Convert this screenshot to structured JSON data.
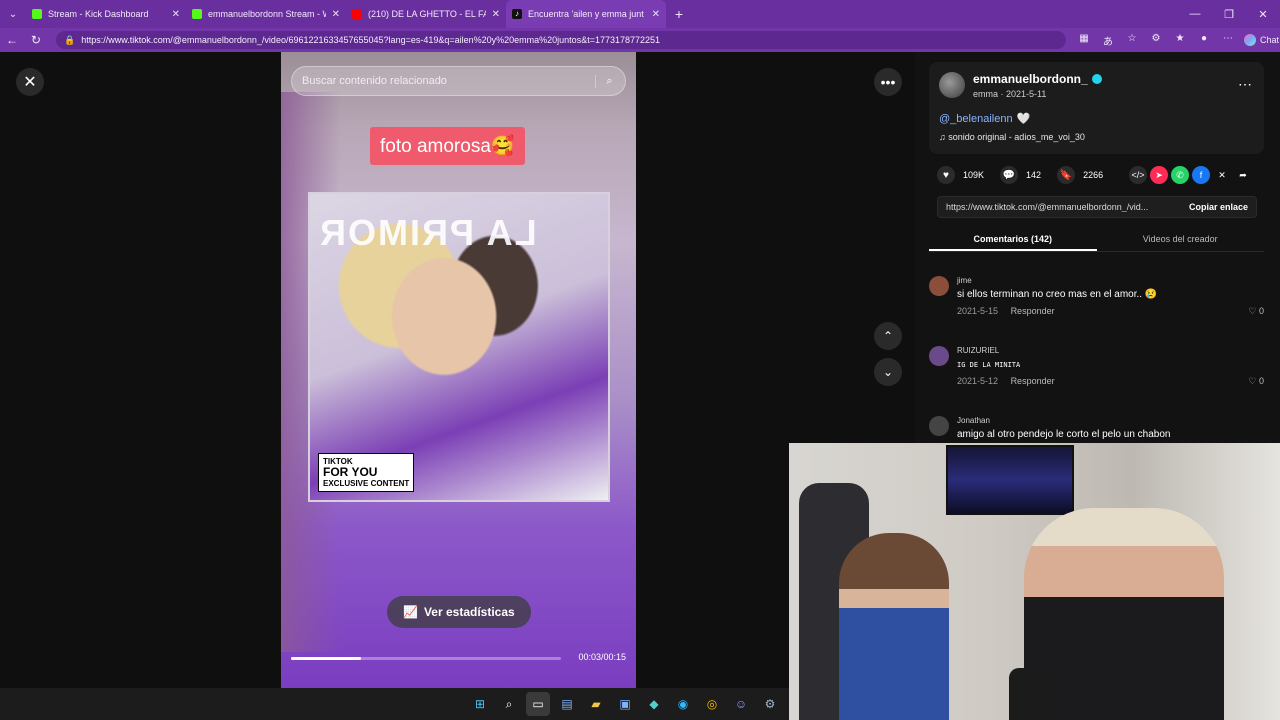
{
  "browser": {
    "tabs": [
      {
        "title": "Stream - Kick Dashboard",
        "favicon_color": "#53fc18"
      },
      {
        "title": "emmanuelbordonn Stream - Watc",
        "favicon_color": "#53fc18"
      },
      {
        "title": "(210) DE LA GHETTO - EL FATHER",
        "favicon_color": "#ff0000"
      },
      {
        "title": "Encuentra 'ailen y emma junt",
        "favicon_color": "#ffffff"
      }
    ],
    "url": "https://www.tiktok.com/@emmanuelbordonn_/video/6961221633457655045?lang=es-419&q=ailen%20y%20emma%20juntos&t=1773178772251",
    "chat_label": "Chat"
  },
  "video": {
    "search_placeholder": "Buscar contenido relacionado",
    "caption_text": "foto amorosa🥰",
    "photo_overlay_text": "LA PRIMOR",
    "stamp_line1": "TIKTOK",
    "stamp_line2": "FOR YOU",
    "stamp_line3": "EXCLUSIVE CONTENT",
    "stats_button": "Ver estadísticas",
    "time": "00:03/00:15",
    "progress_fraction": 0.26
  },
  "panel": {
    "username": "emmanuelbordonn_",
    "subline": "emma · 2021-5-11",
    "mention": "@_belenailenn",
    "sound": "sonido original - adios_me_voi_30",
    "likes": "109K",
    "comments_count": "142",
    "saves": "2266",
    "link": "https://www.tiktok.com/@emmanuelbordonn_/vid...",
    "copy_label": "Copiar enlace",
    "tab_comments": "Comentarios (142)",
    "tab_videos": "Videos del creador",
    "reply_label": "Responder",
    "comments": [
      {
        "user": "jime",
        "text": "si ellos terminan no creo mas en el amor.. 😢",
        "date": "2021-5-15",
        "likes": "0",
        "avatar_color": "#8a4e3a"
      },
      {
        "user": "RUIZURIEL",
        "text": "IG DE LA MINITA",
        "date": "2021-5-12",
        "likes": "0",
        "avatar_color": "#6a4a8a"
      },
      {
        "user": "Jonathan",
        "text": "amigo al otro pendejo le corto el pelo un chabon",
        "date": "",
        "likes": "",
        "avatar_color": "#444444"
      }
    ]
  }
}
